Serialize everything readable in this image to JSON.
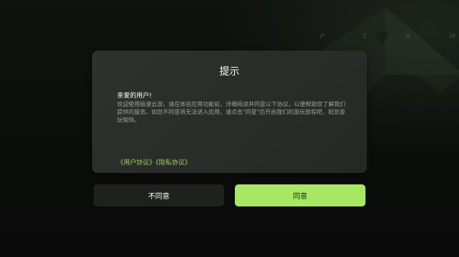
{
  "background": {
    "logo_icon": "diamond-logo-icon",
    "brand_letters": [
      "P",
      "T",
      "R",
      "M"
    ]
  },
  "dialog": {
    "title": "提示",
    "greeting": "亲爱的用户!",
    "body": "欢迎使用极速云游，请在体验应用功能前，详细阅读并同意以下协议，以便帮助您了解我们提供的服务。如您不同意将无法进入应用，请点击\"同意\"后开启我们的游玩旅程吧，祝您游玩愉快。",
    "links": {
      "user_agreement": "《用户协议》",
      "privacy_agreement": "《隐私协议》"
    }
  },
  "buttons": {
    "disagree": "不同意",
    "agree": "同意"
  },
  "colors": {
    "accent": "#a6e764",
    "link": "#9bd35c",
    "dialog_bg": "#2d2f2d",
    "page_bg": "#0b0d0b"
  }
}
